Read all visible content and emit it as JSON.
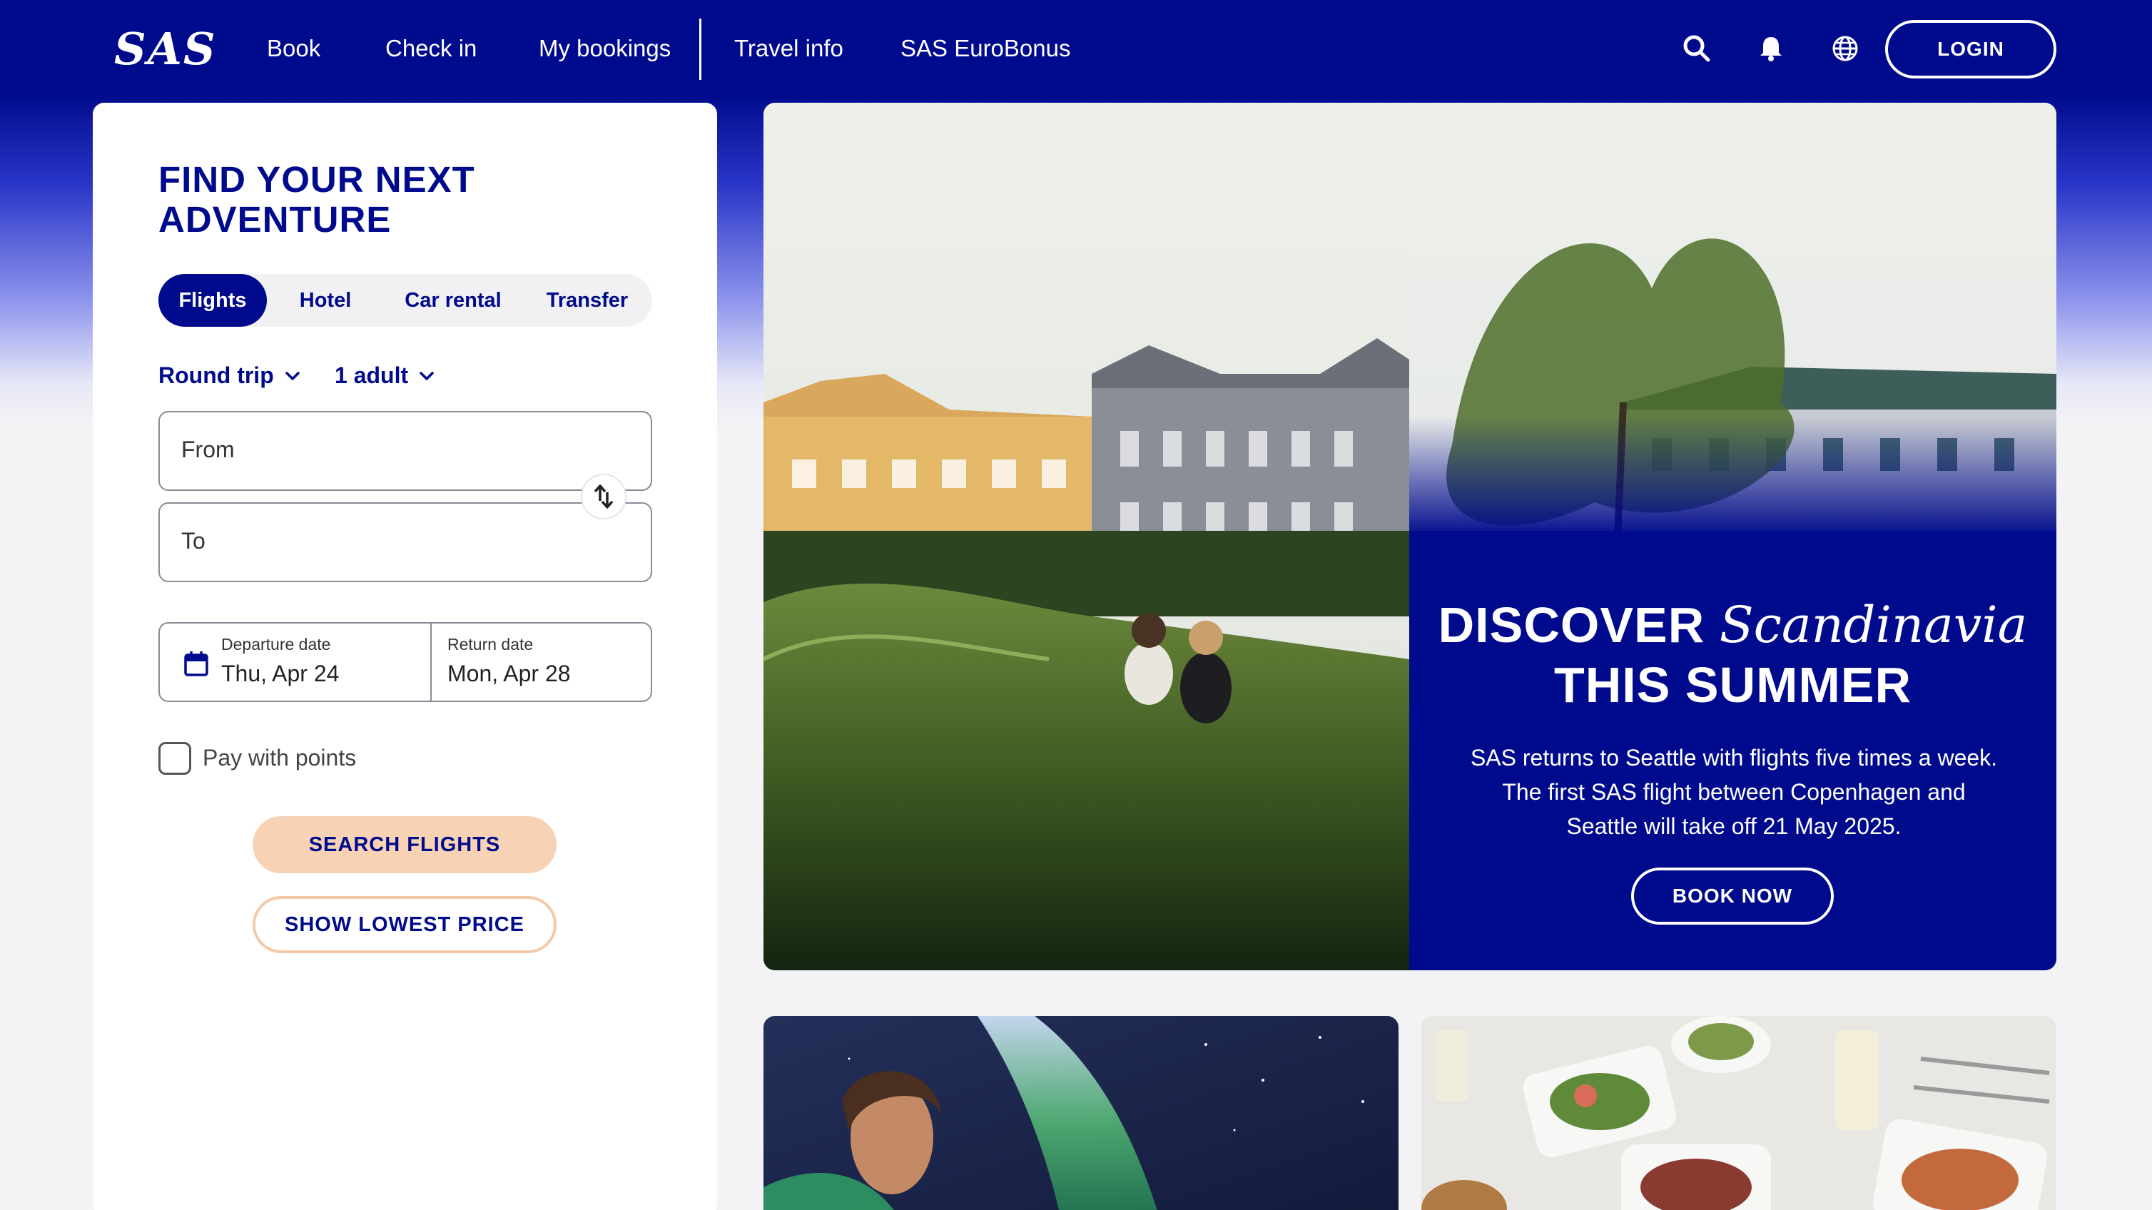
{
  "nav": {
    "logo": "SAS",
    "links": [
      "Book",
      "Check in",
      "My bookings",
      "Travel info",
      "SAS EuroBonus"
    ],
    "icons": [
      "search-icon",
      "bell-icon",
      "globe-icon"
    ],
    "login": "LOGIN"
  },
  "booking": {
    "title": "FIND YOUR NEXT ADVENTURE",
    "tabs": [
      "Flights",
      "Hotel",
      "Car rental",
      "Transfer"
    ],
    "active_tab": "Flights",
    "trip_type": "Round trip",
    "passengers": "1 adult",
    "from_placeholder": "From",
    "to_placeholder": "To",
    "departure_label": "Departure date",
    "departure_value": "Thu, Apr 24",
    "return_label": "Return date",
    "return_value": "Mon, Apr 28",
    "pay_with_points": "Pay with points",
    "search_button": "SEARCH FLIGHTS",
    "lowest_price_button": "SHOW LOWEST PRICE"
  },
  "hero": {
    "title_prefix": "DISCOVER",
    "title_italic": "Scandinavia",
    "title_suffix": "THIS SUMMER",
    "description": "SAS returns to Seattle with flights five times a week. The first SAS flight between Copenhagen and Seattle will take off 21 May 2025.",
    "button": "BOOK NOW"
  },
  "colors": {
    "brand_blue": "#000a8c",
    "accent_peach": "#f8d2b4",
    "background": "#f3f3f5"
  }
}
